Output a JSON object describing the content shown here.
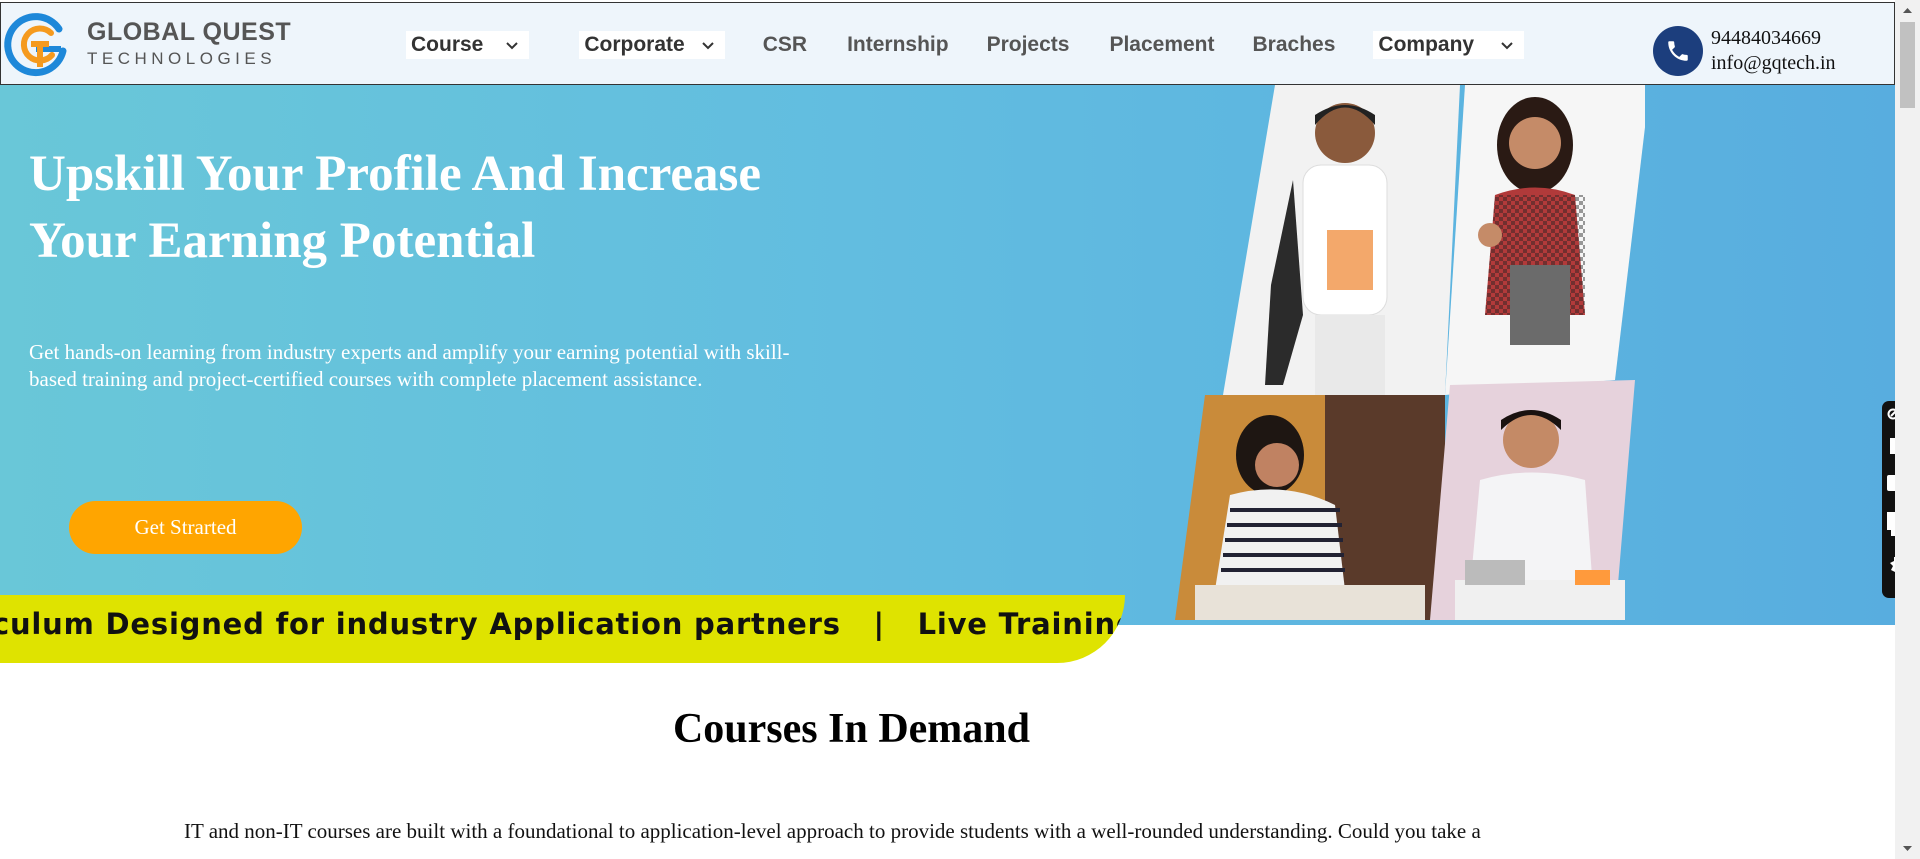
{
  "brand": {
    "name": "GLOBAL QUEST",
    "subtitle": "TECHNOLOGIES",
    "logo_icon": "gqt-logo-icon"
  },
  "nav": {
    "items": [
      {
        "label": "Course",
        "dropdown": true
      },
      {
        "label": "Corporate",
        "dropdown": true
      },
      {
        "label": "CSR",
        "dropdown": false
      },
      {
        "label": "Internship",
        "dropdown": false
      },
      {
        "label": "Projects",
        "dropdown": false
      },
      {
        "label": "Placement",
        "dropdown": false
      },
      {
        "label": "Braches",
        "dropdown": false
      },
      {
        "label": "Company",
        "dropdown": true
      }
    ]
  },
  "contact": {
    "phone": "94484034669",
    "email": "info@gqtech.in",
    "icon": "phone-icon"
  },
  "hero": {
    "title": "Upskill Your Profile And Increase Your Earning Potential",
    "description": "Get hands-on learning from industry experts and amplify your earning potential with skill-based training and project-certified courses with complete placement assistance.",
    "cta_label": "Get Strarted"
  },
  "ticker": {
    "text": "culum Designed for industry Application partners   |   Live Training"
  },
  "courses": {
    "title": "Courses In Demand",
    "description": "IT and non-IT courses are built with a foundational to application-level approach to provide students with a well-rounded understanding. Could you take a"
  },
  "toolbar": {
    "icons": [
      "toolbar-menu-icon",
      "camera-icon",
      "video-camera-icon",
      "window-copy-icon",
      "settings-gear-icon"
    ]
  },
  "colors": {
    "hero_start": "#69c7d8",
    "hero_end": "#58addf",
    "cta": "#ffa500",
    "ticker": "#dfe300",
    "phone_badge": "#1c3e7d",
    "header_bg": "#eef5fb"
  }
}
